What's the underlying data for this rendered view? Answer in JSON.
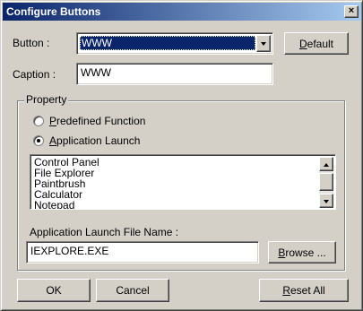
{
  "window": {
    "title": "Configure Buttons",
    "close_glyph": "×"
  },
  "button_row": {
    "label": "Button :",
    "selected_value": "WWW",
    "default_label": "Default"
  },
  "caption_row": {
    "label": "Caption :",
    "value": "WWW"
  },
  "property": {
    "legend": "Property",
    "options": [
      {
        "label": "Predefined Function",
        "checked": false
      },
      {
        "label": "Application Launch",
        "checked": true
      }
    ],
    "applications": [
      "Control Panel",
      "File Explorer",
      "Paintbrush",
      "Calculator",
      "Notepad"
    ]
  },
  "file_row": {
    "label": "Application Launch File Name :",
    "value": "IEXPLORE.EXE",
    "browse_label": "Browse ..."
  },
  "footer": {
    "ok_label": "OK",
    "cancel_label": "Cancel",
    "reset_label": "Reset All"
  },
  "colors": {
    "title_gradient_start": "#0a246a",
    "title_gradient_end": "#a6caf0",
    "face": "#d4d0c8",
    "selection": "#0a246a"
  },
  "icons": {
    "close": "close-icon",
    "dropdown": "chevron-down-icon",
    "scroll_up": "arrow-up-icon",
    "scroll_down": "arrow-down-icon"
  }
}
